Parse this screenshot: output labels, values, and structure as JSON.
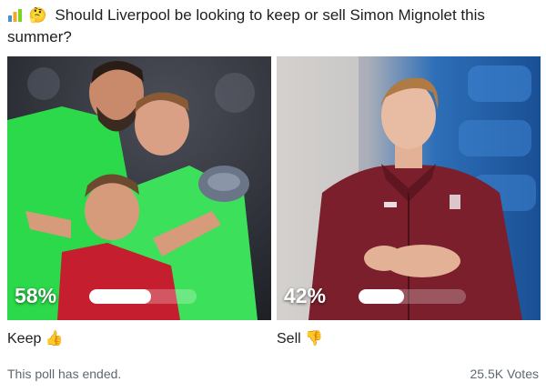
{
  "poll": {
    "question_emoji": "🤔",
    "question": "Should Liverpool be looking to keep or sell Simon Mignolet this summer?",
    "options": [
      {
        "percent_text": "58%",
        "percent": 58,
        "label": "Keep",
        "emoji": "👍"
      },
      {
        "percent_text": "42%",
        "percent": 42,
        "label": "Sell",
        "emoji": "👎"
      }
    ],
    "status": "This poll has ended.",
    "votes": "25.5K Votes"
  },
  "icons": {
    "poll": "bar-chart-icon",
    "keep": "thumbs-up-icon",
    "sell": "thumbs-down-icon"
  },
  "colors": {
    "keep_kit": "#2bd94a",
    "sell_jacket": "#7a1f2b",
    "bar_fill": "#ffffff"
  }
}
